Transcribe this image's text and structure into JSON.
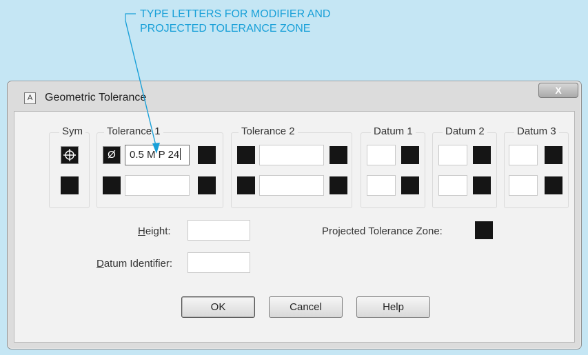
{
  "annotation": {
    "line1": "TYPE LETTERS FOR MODIFIER AND",
    "line2": "PROJECTED TOLERANCE ZONE"
  },
  "dialog": {
    "title": "Geometric Tolerance",
    "close_glyph": "X",
    "icon_glyph": "A"
  },
  "groups": {
    "sym": "Sym",
    "tolerance1": "Tolerance 1",
    "tolerance2": "Tolerance 2",
    "datum1": "Datum 1",
    "datum2": "Datum 2",
    "datum3": "Datum 3"
  },
  "symbols": {
    "position_icon": "position-icon",
    "diameter_glyph": "Ø"
  },
  "fields": {
    "tolerance1_row1": "0.5 M P 24",
    "tolerance1_row2": "",
    "tolerance2_row1": "",
    "tolerance2_row2": "",
    "datum1_row1": "",
    "datum1_row2": "",
    "datum2_row1": "",
    "datum2_row2": "",
    "datum3_row1": "",
    "datum3_row2": "",
    "height": "",
    "datum_identifier": ""
  },
  "labels": {
    "height_key": "H",
    "height_rest": "eight:",
    "datum_id_key": "D",
    "datum_id_rest": "atum Identifier:",
    "projected_zone": "Projected Tolerance Zone:"
  },
  "buttons": {
    "ok": "OK",
    "cancel": "Cancel",
    "help": "Help"
  },
  "colors": {
    "background": "#c5e6f4",
    "annotation": "#19a0d8",
    "swatch": "#151515"
  }
}
